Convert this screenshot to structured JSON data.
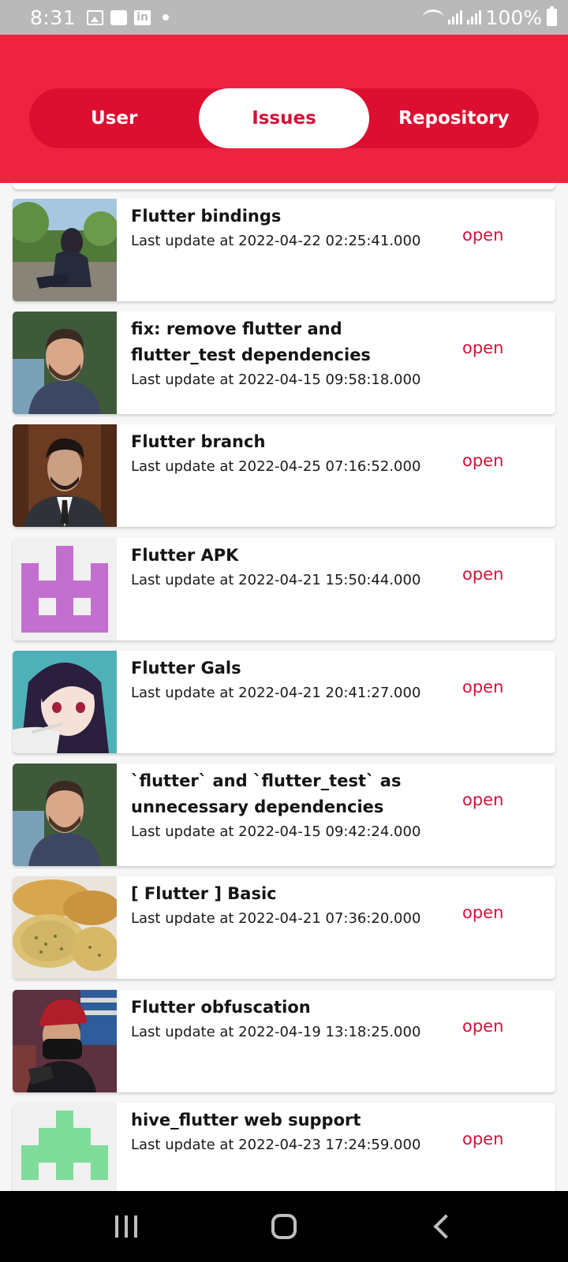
{
  "status_bar": {
    "time": "8:31",
    "battery": "100%"
  },
  "tabs": [
    {
      "label": "User",
      "active": false
    },
    {
      "label": "Issues",
      "active": true
    },
    {
      "label": "Repository",
      "active": false
    }
  ],
  "issues": [
    {
      "title": "Flutter bindings",
      "updated": "Last update at 2022-04-22 02:25:41.000",
      "status": "open",
      "avatar": "photo-person-outdoors"
    },
    {
      "title": "fix: remove flutter and flutter_test dependencies",
      "updated": "Last update at 2022-04-15 09:58:18.000",
      "status": "open",
      "avatar": "photo-man-portrait"
    },
    {
      "title": "Flutter branch",
      "updated": "Last update at 2022-04-25 07:16:52.000",
      "status": "open",
      "avatar": "photo-man-suit"
    },
    {
      "title": "Flutter APK",
      "updated": "Last update at 2022-04-21 15:50:44.000",
      "status": "open",
      "avatar": "identicon-purple"
    },
    {
      "title": "Flutter Gals",
      "updated": "Last update at 2022-04-21 20:41:27.000",
      "status": "open",
      "avatar": "anime-girl-avatar"
    },
    {
      "title": "`flutter` and `flutter_test` as unnecessary dependencies",
      "updated": "Last update at 2022-04-15 09:42:24.000",
      "status": "open",
      "avatar": "photo-man-portrait"
    },
    {
      "title": "[ Flutter ] Basic",
      "updated": "Last update at 2022-04-21 07:36:20.000",
      "status": "open",
      "avatar": "photo-garlic-bread"
    },
    {
      "title": "Flutter obfuscation",
      "updated": "Last update at 2022-04-19 13:18:25.000",
      "status": "open",
      "avatar": "photo-man-red-cap"
    },
    {
      "title": "hive_flutter web support",
      "updated": "Last update at 2022-04-23 17:24:59.000",
      "status": "open",
      "avatar": "identicon-green"
    }
  ],
  "colors": {
    "primary": "#ee2340",
    "segment_bg": "#dc0f30",
    "accent": "#d3123a"
  }
}
